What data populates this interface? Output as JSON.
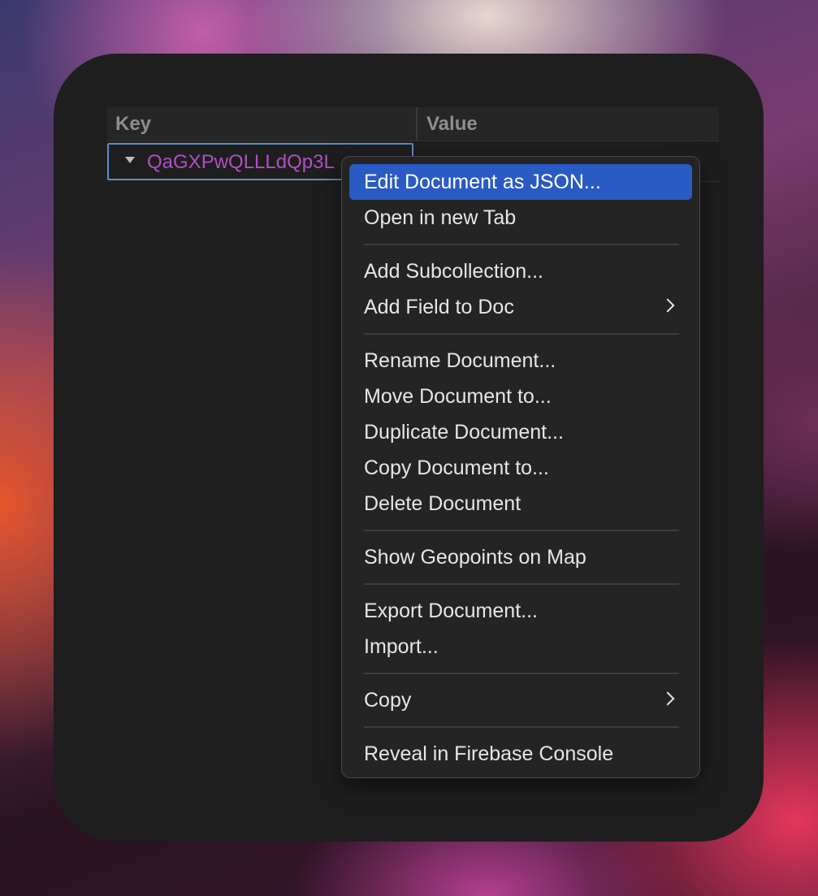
{
  "table": {
    "columns": {
      "key": "Key",
      "value": "Value"
    },
    "row": {
      "key": "QaGXPwQLLLdQp3L"
    }
  },
  "context_menu": {
    "items": [
      {
        "label": "Edit Document as JSON...",
        "highlighted": true
      },
      {
        "label": "Open in new Tab"
      },
      {
        "label": "Add Subcollection..."
      },
      {
        "label": "Add Field to Doc",
        "submenu": true
      },
      {
        "label": "Rename Document..."
      },
      {
        "label": "Move Document to..."
      },
      {
        "label": "Duplicate Document..."
      },
      {
        "label": "Copy Document to..."
      },
      {
        "label": "Delete Document"
      },
      {
        "label": "Show Geopoints on Map"
      },
      {
        "label": "Export Document..."
      },
      {
        "label": "Import..."
      },
      {
        "label": "Copy",
        "submenu": true
      },
      {
        "label": "Reveal in Firebase Console"
      }
    ]
  },
  "colors": {
    "highlight": "#2a5bc4",
    "document_id": "#b04fc4",
    "selection_border": "#5b8ec9"
  }
}
